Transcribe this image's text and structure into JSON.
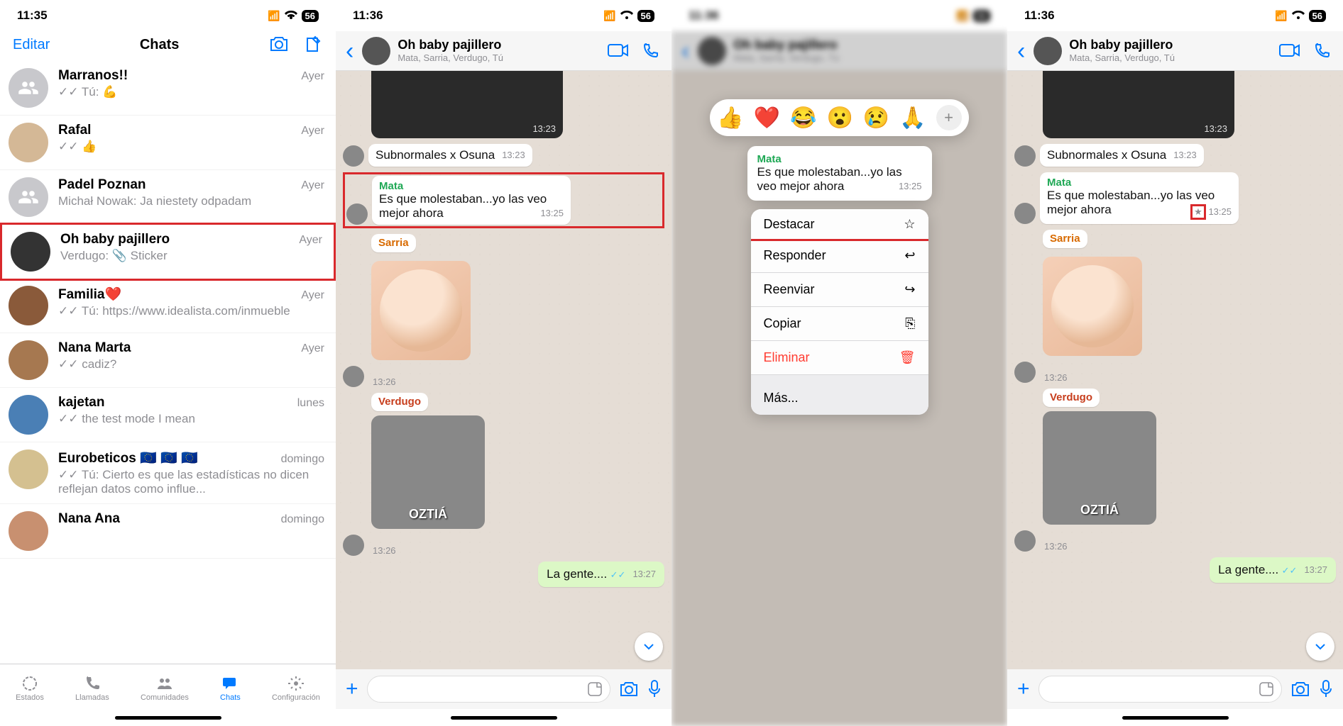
{
  "status": {
    "time1": "11:35",
    "time2": "11:36",
    "battery": "56"
  },
  "list": {
    "edit": "Editar",
    "title": "Chats",
    "items": [
      {
        "name": "Marranos!!",
        "msg": "✓✓ Tú: 💪",
        "time": "Ayer"
      },
      {
        "name": "Rafal",
        "msg": "✓✓ 👍",
        "time": "Ayer"
      },
      {
        "name": "Padel Poznan",
        "msg": "Michał Nowak: Ja niestety odpadam",
        "time": "Ayer"
      },
      {
        "name": "Oh baby pajillero",
        "msg": "Verdugo: 📎 Sticker",
        "time": "Ayer"
      },
      {
        "name": "Familia❤️",
        "msg": "✓✓ Tú: https://www.idealista.com/inmueble",
        "time": "Ayer"
      },
      {
        "name": "Nana Marta",
        "msg": "✓✓ cadiz?",
        "time": "Ayer"
      },
      {
        "name": "kajetan",
        "msg": "✓✓ the test mode I mean",
        "time": "lunes"
      },
      {
        "name": "Eurobeticos 🇪🇺 🇪🇺 🇪🇺",
        "msg": "✓✓ Tú: Cierto es que las estadísticas no dicen reflejan datos como influe...",
        "time": "domingo"
      },
      {
        "name": "Nana Ana",
        "msg": "",
        "time": "domingo"
      }
    ],
    "tabs": {
      "estados": "Estados",
      "llamadas": "Llamadas",
      "comunidades": "Comunidades",
      "chats": "Chats",
      "config": "Configuración"
    }
  },
  "chat": {
    "title": "Oh baby pajillero",
    "members": "Mata, Sarria, Verdugo, Tú",
    "media_time": "13:23",
    "m1": {
      "text": "Subnormales x Osuna",
      "time": "13:23"
    },
    "m2": {
      "sender": "Mata",
      "text": "Es que molestaban...yo las veo mejor ahora",
      "time": "13:25"
    },
    "m3": {
      "sender": "Sarria",
      "sticker_time": "13:26"
    },
    "m4": {
      "sender": "Verdugo",
      "sticker_text": "OZTIÁ",
      "sticker_time": "13:26"
    },
    "out": {
      "text": "La gente....",
      "time": "13:27"
    }
  },
  "reactions": [
    "👍",
    "❤️",
    "😂",
    "😮",
    "😢",
    "🙏"
  ],
  "menu": {
    "destacar": "Destacar",
    "responder": "Responder",
    "reenviar": "Reenviar",
    "copiar": "Copiar",
    "eliminar": "Eliminar",
    "mas": "Más..."
  }
}
